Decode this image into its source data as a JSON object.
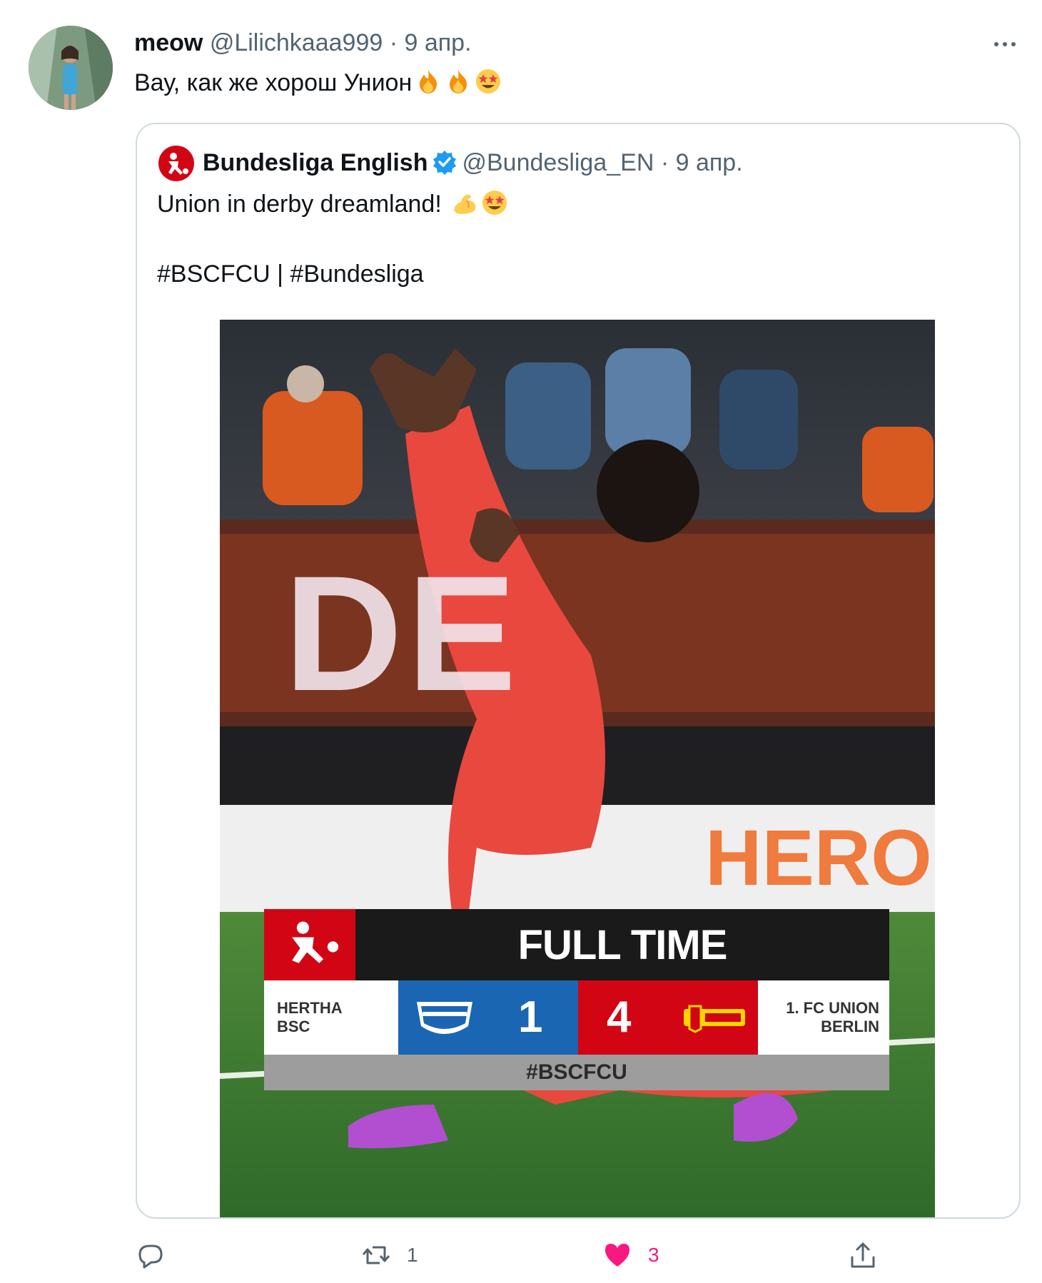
{
  "tweet": {
    "name": "meow",
    "handle": "@Lilichkaaa999",
    "separator": "·",
    "date": "9 апр.",
    "text": "Вау, как же хорош Унион",
    "avatar_icon": "user-avatar-photo"
  },
  "quoted": {
    "name": "Bundesliga English",
    "handle": "@Bundesliga_EN",
    "separator": "·",
    "date": "9 апр.",
    "text": "Union in derby dreamland!",
    "hashtags": "#BSCFCU | #Bundesliga",
    "avatar_icon": "bundesliga-logo",
    "verified_icon": "verified-badge"
  },
  "media": {
    "banner_text": "DE",
    "board_text": "HERO",
    "scoreboard": {
      "header": "FULL TIME",
      "home_team_line1": "HERTHA",
      "home_team_line2": "BSC",
      "home_score": "1",
      "away_score": "4",
      "away_team_line1": "1. FC UNION",
      "away_team_line2": "BERLIN",
      "hashtag": "#BSCFCU"
    }
  },
  "actions": {
    "reply_count": "",
    "retweet_count": "1",
    "like_count": "3",
    "liked": true
  },
  "colors": {
    "bundesliga_red": "#d20515",
    "hertha_blue": "#1b66b3",
    "like_pink": "#f91880",
    "secondary_text": "#536471",
    "border": "#cfd9de"
  }
}
